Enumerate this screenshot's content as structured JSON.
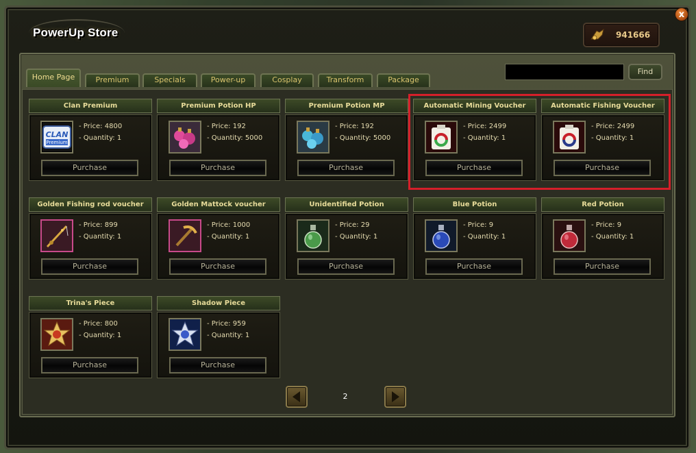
{
  "window": {
    "title": "PowerUp Store",
    "close_label": "x",
    "gold": "941666"
  },
  "tabs": [
    {
      "label": "Home Page",
      "active": true
    },
    {
      "label": "Premium"
    },
    {
      "label": "Specials"
    },
    {
      "label": "Power-up"
    },
    {
      "label": "Cosplay"
    },
    {
      "label": "Transform"
    },
    {
      "label": "Package"
    }
  ],
  "search": {
    "value": "",
    "find_label": "Find"
  },
  "items": [
    {
      "name": "Clan Premium",
      "price": "- Price: 4800",
      "quantity": "- Quantity: 1",
      "purchase": "Purchase",
      "icon": "clan-premium-icon"
    },
    {
      "name": "Premium Potion HP",
      "price": "- Price: 192",
      "quantity": "- Quantity: 5000",
      "purchase": "Purchase",
      "icon": "hp-potions-icon"
    },
    {
      "name": "Premium Potion MP",
      "price": "- Price: 192",
      "quantity": "- Quantity: 5000",
      "purchase": "Purchase",
      "icon": "mp-potions-icon"
    },
    {
      "name": "Automatic Mining Voucher",
      "price": "- Price: 2499",
      "quantity": "- Quantity: 1",
      "purchase": "Purchase",
      "icon": "mining-voucher-icon"
    },
    {
      "name": "Automatic Fishing Voucher",
      "price": "- Price: 2499",
      "quantity": "- Quantity: 1",
      "purchase": "Purchase",
      "icon": "fishing-voucher-icon"
    },
    {
      "name": "Golden Fishing rod voucher",
      "price": "- Price: 899",
      "quantity": "- Quantity: 1",
      "purchase": "Purchase",
      "icon": "fishing-rod-icon"
    },
    {
      "name": "Golden Mattock voucher",
      "price": "- Price: 1000",
      "quantity": "- Quantity: 1",
      "purchase": "Purchase",
      "icon": "mattock-icon"
    },
    {
      "name": "Unidentified Potion",
      "price": "- Price: 29",
      "quantity": "- Quantity: 1",
      "purchase": "Purchase",
      "icon": "green-potion-icon"
    },
    {
      "name": "Blue Potion",
      "price": "- Price: 9",
      "quantity": "- Quantity: 1",
      "purchase": "Purchase",
      "icon": "blue-potion-icon"
    },
    {
      "name": "Red Potion",
      "price": "- Price: 9",
      "quantity": "- Quantity: 1",
      "purchase": "Purchase",
      "icon": "red-potion-icon"
    },
    {
      "name": "Trina's Piece",
      "price": "- Price: 800",
      "quantity": "- Quantity: 1",
      "purchase": "Purchase",
      "icon": "trina-piece-icon"
    },
    {
      "name": "Shadow Piece",
      "price": "- Price: 959",
      "quantity": "- Quantity: 1",
      "purchase": "Purchase",
      "icon": "shadow-piece-icon"
    }
  ],
  "pagination": {
    "page": "2"
  },
  "colors": {
    "highlight": "#d51f2a",
    "label_gold": "#e8dc9a"
  }
}
